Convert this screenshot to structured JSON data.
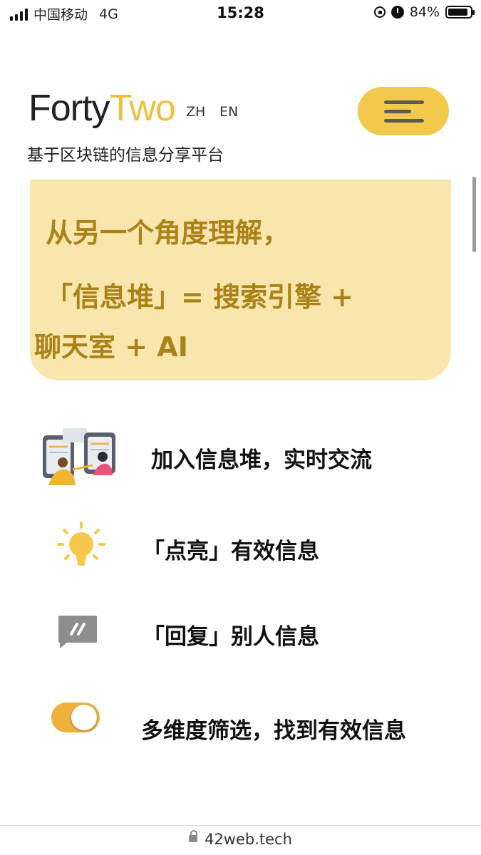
{
  "status_bar": {
    "carrier": "中国移动",
    "network": "4G",
    "time": "15:28",
    "battery": "84%"
  },
  "header": {
    "logo_part1": "Forty",
    "logo_part2": "Two",
    "lang_zh": "ZH",
    "lang_en": "EN",
    "tagline": "基于区块链的信息分享平台",
    "menu_icon": "hamburger-icon"
  },
  "banner": {
    "line1": "从另一个角度理解，",
    "line2": "「信息堆」= 搜索引擎 +",
    "line3": "聊天室 + AI"
  },
  "features": [
    {
      "icon": "people-chat-icon",
      "text": "加入信息堆，实时交流"
    },
    {
      "icon": "lightbulb-icon",
      "text": "「点亮」有效信息"
    },
    {
      "icon": "reply-icon",
      "text": "「回复」别人信息"
    },
    {
      "icon": "toggle-icon",
      "text": "多维度筛选，找到有效信息"
    }
  ],
  "url_bar": {
    "url": "42web.tech"
  },
  "colors": {
    "accent": "#f3c94c",
    "banner_bg": "#f9e6ad",
    "banner_text": "#a98218",
    "toggle": "#eeb23c"
  }
}
